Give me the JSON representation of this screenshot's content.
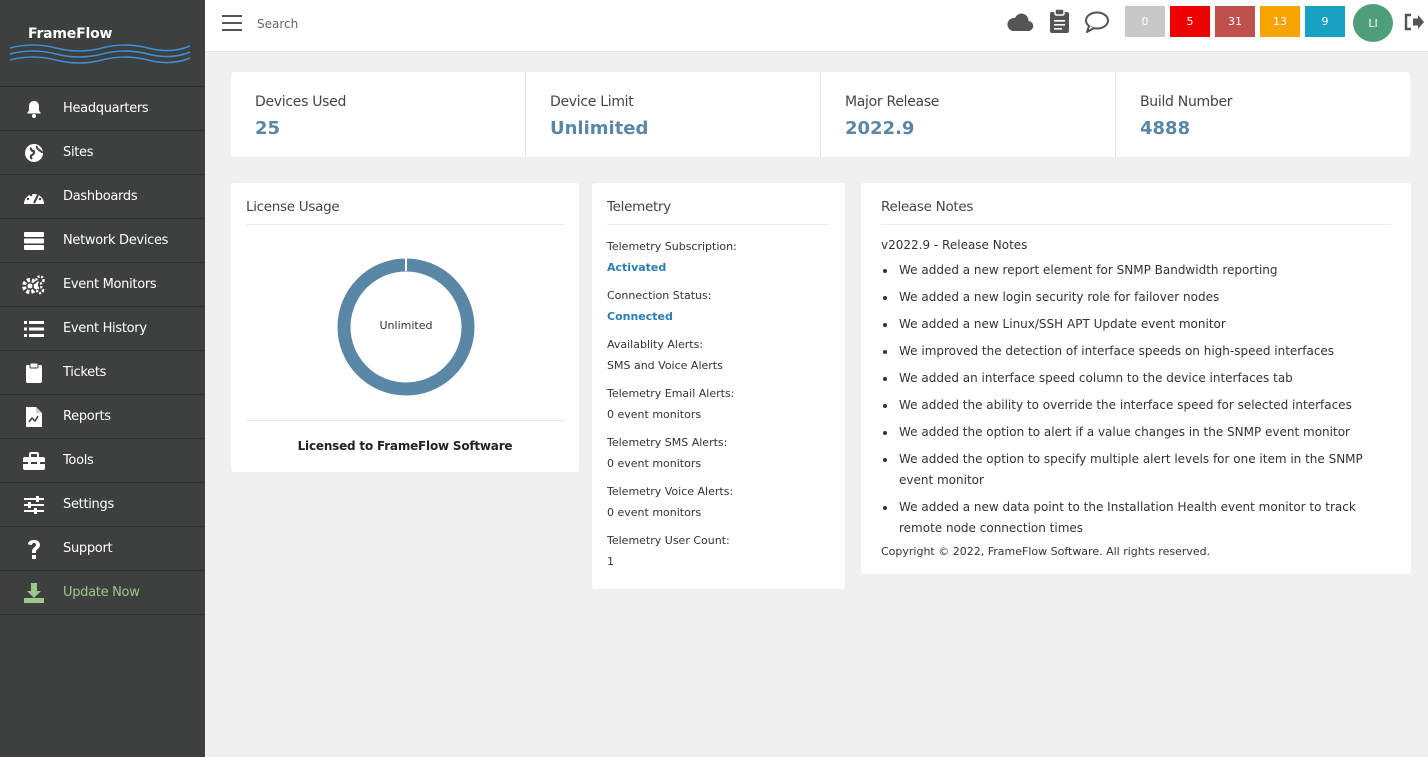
{
  "app": {
    "logo": "FrameFlow"
  },
  "sidebar": {
    "items": [
      {
        "label": "Headquarters",
        "icon": "bell-icon"
      },
      {
        "label": "Sites",
        "icon": "globe-icon"
      },
      {
        "label": "Dashboards",
        "icon": "gauge-icon"
      },
      {
        "label": "Network Devices",
        "icon": "server-icon"
      },
      {
        "label": "Event Monitors",
        "icon": "gears-icon"
      },
      {
        "label": "Event History",
        "icon": "list-icon"
      },
      {
        "label": "Tickets",
        "icon": "clipboard-icon"
      },
      {
        "label": "Reports",
        "icon": "report-file-icon"
      },
      {
        "label": "Tools",
        "icon": "toolbox-icon"
      },
      {
        "label": "Settings",
        "icon": "sliders-icon"
      },
      {
        "label": "Support",
        "icon": "question-icon"
      },
      {
        "label": "Update Now",
        "icon": "download-icon"
      }
    ]
  },
  "topbar": {
    "search_placeholder": "Search",
    "badges": [
      {
        "value": "0",
        "color": "#c8c8c8"
      },
      {
        "value": "5",
        "color": "#ee0000"
      },
      {
        "value": "31",
        "color": "#c0504d"
      },
      {
        "value": "13",
        "color": "#f7a400"
      },
      {
        "value": "9",
        "color": "#17a2c4"
      }
    ],
    "avatar_initials": "LI"
  },
  "stats": [
    {
      "label": "Devices Used",
      "value": "25"
    },
    {
      "label": "Device Limit",
      "value": "Unlimited"
    },
    {
      "label": "Major Release",
      "value": "2022.9"
    },
    {
      "label": "Build Number",
      "value": "4888"
    }
  ],
  "license": {
    "title": "License Usage",
    "donut_label": "Unlimited",
    "donut_color": "#5b87a6",
    "licensed_to": "Licensed to FrameFlow Software"
  },
  "telemetry": {
    "title": "Telemetry",
    "items": [
      {
        "label": "Telemetry Subscription:",
        "value": "Activated",
        "highlight": true
      },
      {
        "label": "Connection Status:",
        "value": "Connected",
        "highlight": true
      },
      {
        "label": "Availablity Alerts:",
        "value": "SMS and Voice Alerts",
        "highlight": false
      },
      {
        "label": "Telemetry Email Alerts:",
        "value": "0 event monitors",
        "highlight": false
      },
      {
        "label": "Telemetry SMS Alerts:",
        "value": "0 event monitors",
        "highlight": false
      },
      {
        "label": "Telemetry Voice Alerts:",
        "value": "0 event monitors",
        "highlight": false
      },
      {
        "label": "Telemetry User Count:",
        "value": "1",
        "highlight": false
      }
    ]
  },
  "release_notes": {
    "title": "Release Notes",
    "heading": "v2022.9 - Release Notes",
    "items": [
      "We added a new report element for SNMP Bandwidth reporting",
      "We added a new login security role for failover nodes",
      "We added a new Linux/SSH APT Update event monitor",
      "We improved the detection of interface speeds on high-speed interfaces",
      "We added an interface speed column to the device interfaces tab",
      "We added the ability to override the interface speed for selected interfaces",
      "We added the option to alert if a value changes in the SNMP event monitor",
      "We added the option to specify multiple alert levels for one item in the SNMP event monitor",
      "We added a new data point to the Installation Health event monitor to track remote node connection times"
    ],
    "copyright": "Copyright © 2022, FrameFlow Software. All rights reserved."
  }
}
